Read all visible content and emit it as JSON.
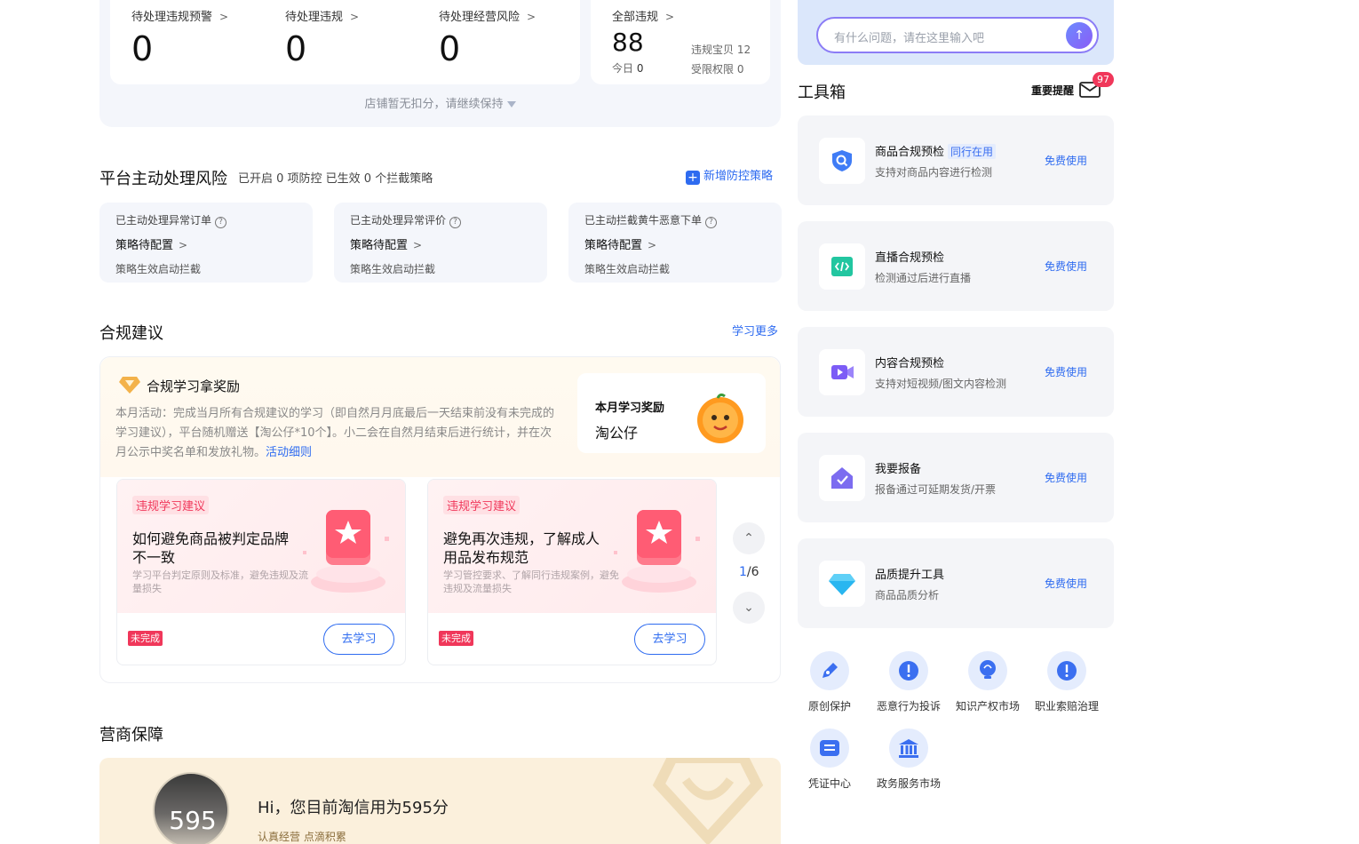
{
  "stats": {
    "items": [
      {
        "label": "待处理违规预警",
        "value": "0"
      },
      {
        "label": "待处理违规",
        "value": "0"
      },
      {
        "label": "待处理经营风险",
        "value": "0"
      }
    ],
    "all": {
      "label": "全部违规",
      "value": "88",
      "today_label": "今日",
      "today_value": "0",
      "baby_label": "违规宝贝",
      "baby_value": "12",
      "limit_label": "受限权限",
      "limit_value": "0"
    },
    "hint": "店铺暂无扣分，请继续保持"
  },
  "platform": {
    "title": "平台主动处理风险",
    "subtitle": "已开启 0 项防控 已生效 0 个拦截策略",
    "add_label": "新增防控策略",
    "cards": [
      {
        "title": "已主动处理异常订单",
        "status": "策略待配置",
        "note": "策略生效启动拦截"
      },
      {
        "title": "已主动处理异常评价",
        "status": "策略待配置",
        "note": "策略生效启动拦截"
      },
      {
        "title": "已主动拦截黄牛恶意下单",
        "status": "策略待配置",
        "note": "策略生效启动拦截"
      }
    ]
  },
  "compliance": {
    "title": "合规建议",
    "more": "学习更多",
    "reward_title": "合规学习拿奖励",
    "reward_desc": "本月活动：完成当月所有合规建议的学习（即自然月月底最后一天结束前没有未完成的学习建议），平台随机赠送【淘公仔*10个】。小二会在自然月结束后进行统计，并在次月公示中奖名单和发放礼物。",
    "reward_link": "活动细则",
    "box_title": "本月学习奖励",
    "box_prize": "淘公仔",
    "cards": [
      {
        "tag": "违规学习建议",
        "title": "如何避免商品被判定品牌不一致",
        "desc": "学习平台判定原则及标准，避免违规及流量损失",
        "status": "未完成",
        "button": "去学习"
      },
      {
        "tag": "违规学习建议",
        "title": "避免再次违规，了解成人用品发布规范",
        "desc": "学习管控要求、了解同行违规案例，避免违规及流量损失",
        "status": "未完成",
        "button": "去学习"
      }
    ],
    "pager_current": "1",
    "pager_total": "/6"
  },
  "guarantee": {
    "title": "营商保障",
    "score": "595",
    "hi": "Hi，您目前淘信用为595分",
    "sub": "认真经营 点滴积累"
  },
  "ask": {
    "placeholder": "有什么问题，请在这里输入吧"
  },
  "toolbox": {
    "title": "工具箱",
    "remind": "重要提醒",
    "remind_count": "97",
    "tools": [
      {
        "name": "商品合规预检",
        "badge": "同行在用",
        "desc": "支持对商品内容进行检测",
        "link": "免费使用",
        "icon": "shield-search-icon"
      },
      {
        "name": "直播合规预检",
        "badge": "",
        "desc": "检测通过后进行直播",
        "link": "免费使用",
        "icon": "code-icon"
      },
      {
        "name": "内容合规预检",
        "badge": "",
        "desc": "支持对短视频/图文内容检测",
        "link": "免费使用",
        "icon": "video-icon"
      },
      {
        "name": "我要报备",
        "badge": "",
        "desc": "报备通过可延期发货/开票",
        "link": "免费使用",
        "icon": "check-badge-icon"
      },
      {
        "name": "品质提升工具",
        "badge": "",
        "desc": "商品品质分析",
        "link": "免费使用",
        "icon": "diamond-icon"
      }
    ],
    "quick": [
      {
        "label": "原创保护"
      },
      {
        "label": "恶意行为投诉"
      },
      {
        "label": "知识产权市场"
      },
      {
        "label": "职业索赔治理"
      },
      {
        "label": "凭证中心"
      },
      {
        "label": "政务服务市场"
      }
    ]
  },
  "colors": {
    "accent": "#2e6bf0",
    "danger": "#f0375a",
    "panel": "#f4f6fb"
  }
}
